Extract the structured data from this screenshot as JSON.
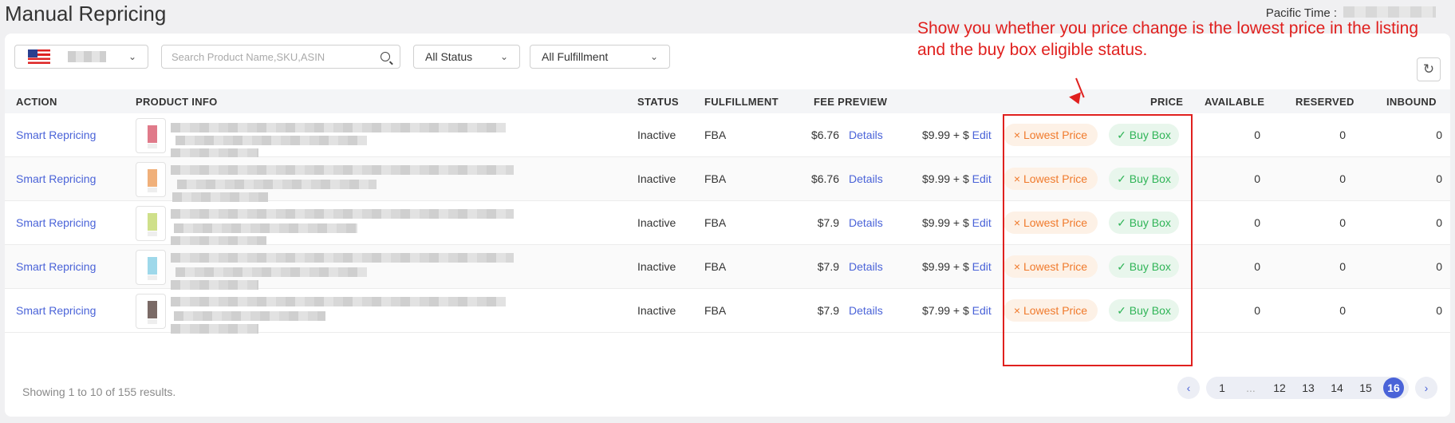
{
  "page": {
    "title": "Manual Repricing",
    "pacific_time_label": "Pacific Time :"
  },
  "filters": {
    "search_placeholder": "Search Product Name,SKU,ASIN",
    "status": "All Status",
    "fulfillment": "All Fulfillment"
  },
  "table": {
    "headers": {
      "action": "ACTION",
      "product_info": "PRODUCT INFO",
      "status": "STATUS",
      "fulfillment": "FULFILLMENT",
      "fee_preview": "FEE PREVIEW",
      "price": "PRICE",
      "available": "AVAILABLE",
      "reserved": "RESERVED",
      "inbound": "INBOUND"
    },
    "rows": [
      {
        "action": "Smart Repricing",
        "status": "Inactive",
        "fulfillment": "FBA",
        "fee": "$6.76",
        "details": "Details",
        "price": "$9.99 + $",
        "edit": "Edit",
        "lowest": "Lowest Price",
        "buybox": "Buy Box",
        "available": "0",
        "reserved": "0",
        "inbound": "0",
        "swatch": "#e07a8a"
      },
      {
        "action": "Smart Repricing",
        "status": "Inactive",
        "fulfillment": "FBA",
        "fee": "$6.76",
        "details": "Details",
        "price": "$9.99 + $",
        "edit": "Edit",
        "lowest": "Lowest Price",
        "buybox": "Buy Box",
        "available": "0",
        "reserved": "0",
        "inbound": "0",
        "swatch": "#f0b07a"
      },
      {
        "action": "Smart Repricing",
        "status": "Inactive",
        "fulfillment": "FBA",
        "fee": "$7.9",
        "details": "Details",
        "price": "$9.99 + $",
        "edit": "Edit",
        "lowest": "Lowest Price",
        "buybox": "Buy Box",
        "available": "0",
        "reserved": "0",
        "inbound": "0",
        "swatch": "#cfe08a"
      },
      {
        "action": "Smart Repricing",
        "status": "Inactive",
        "fulfillment": "FBA",
        "fee": "$7.9",
        "details": "Details",
        "price": "$9.99 + $",
        "edit": "Edit",
        "lowest": "Lowest Price",
        "buybox": "Buy Box",
        "available": "0",
        "reserved": "0",
        "inbound": "0",
        "swatch": "#9ed8ea"
      },
      {
        "action": "Smart Repricing",
        "status": "Inactive",
        "fulfillment": "FBA",
        "fee": "$7.9",
        "details": "Details",
        "price": "$7.99 + $",
        "edit": "Edit",
        "lowest": "Lowest Price",
        "buybox": "Buy Box",
        "available": "0",
        "reserved": "0",
        "inbound": "0",
        "swatch": "#7a6a66"
      }
    ]
  },
  "footer": {
    "summary": "Showing 1 to 10 of 155 results.",
    "pages": [
      "1",
      "...",
      "12",
      "13",
      "14",
      "15",
      "16"
    ],
    "active_page": "16"
  },
  "annotation": {
    "text": "Show you whether you price change is the lowest price in the listing and the buy box eligible status."
  },
  "colors": {
    "accent": "#4a63d8",
    "annotation": "#e0201e",
    "lowest_tag": "#f07a2c",
    "buybox_tag": "#2fb457"
  }
}
